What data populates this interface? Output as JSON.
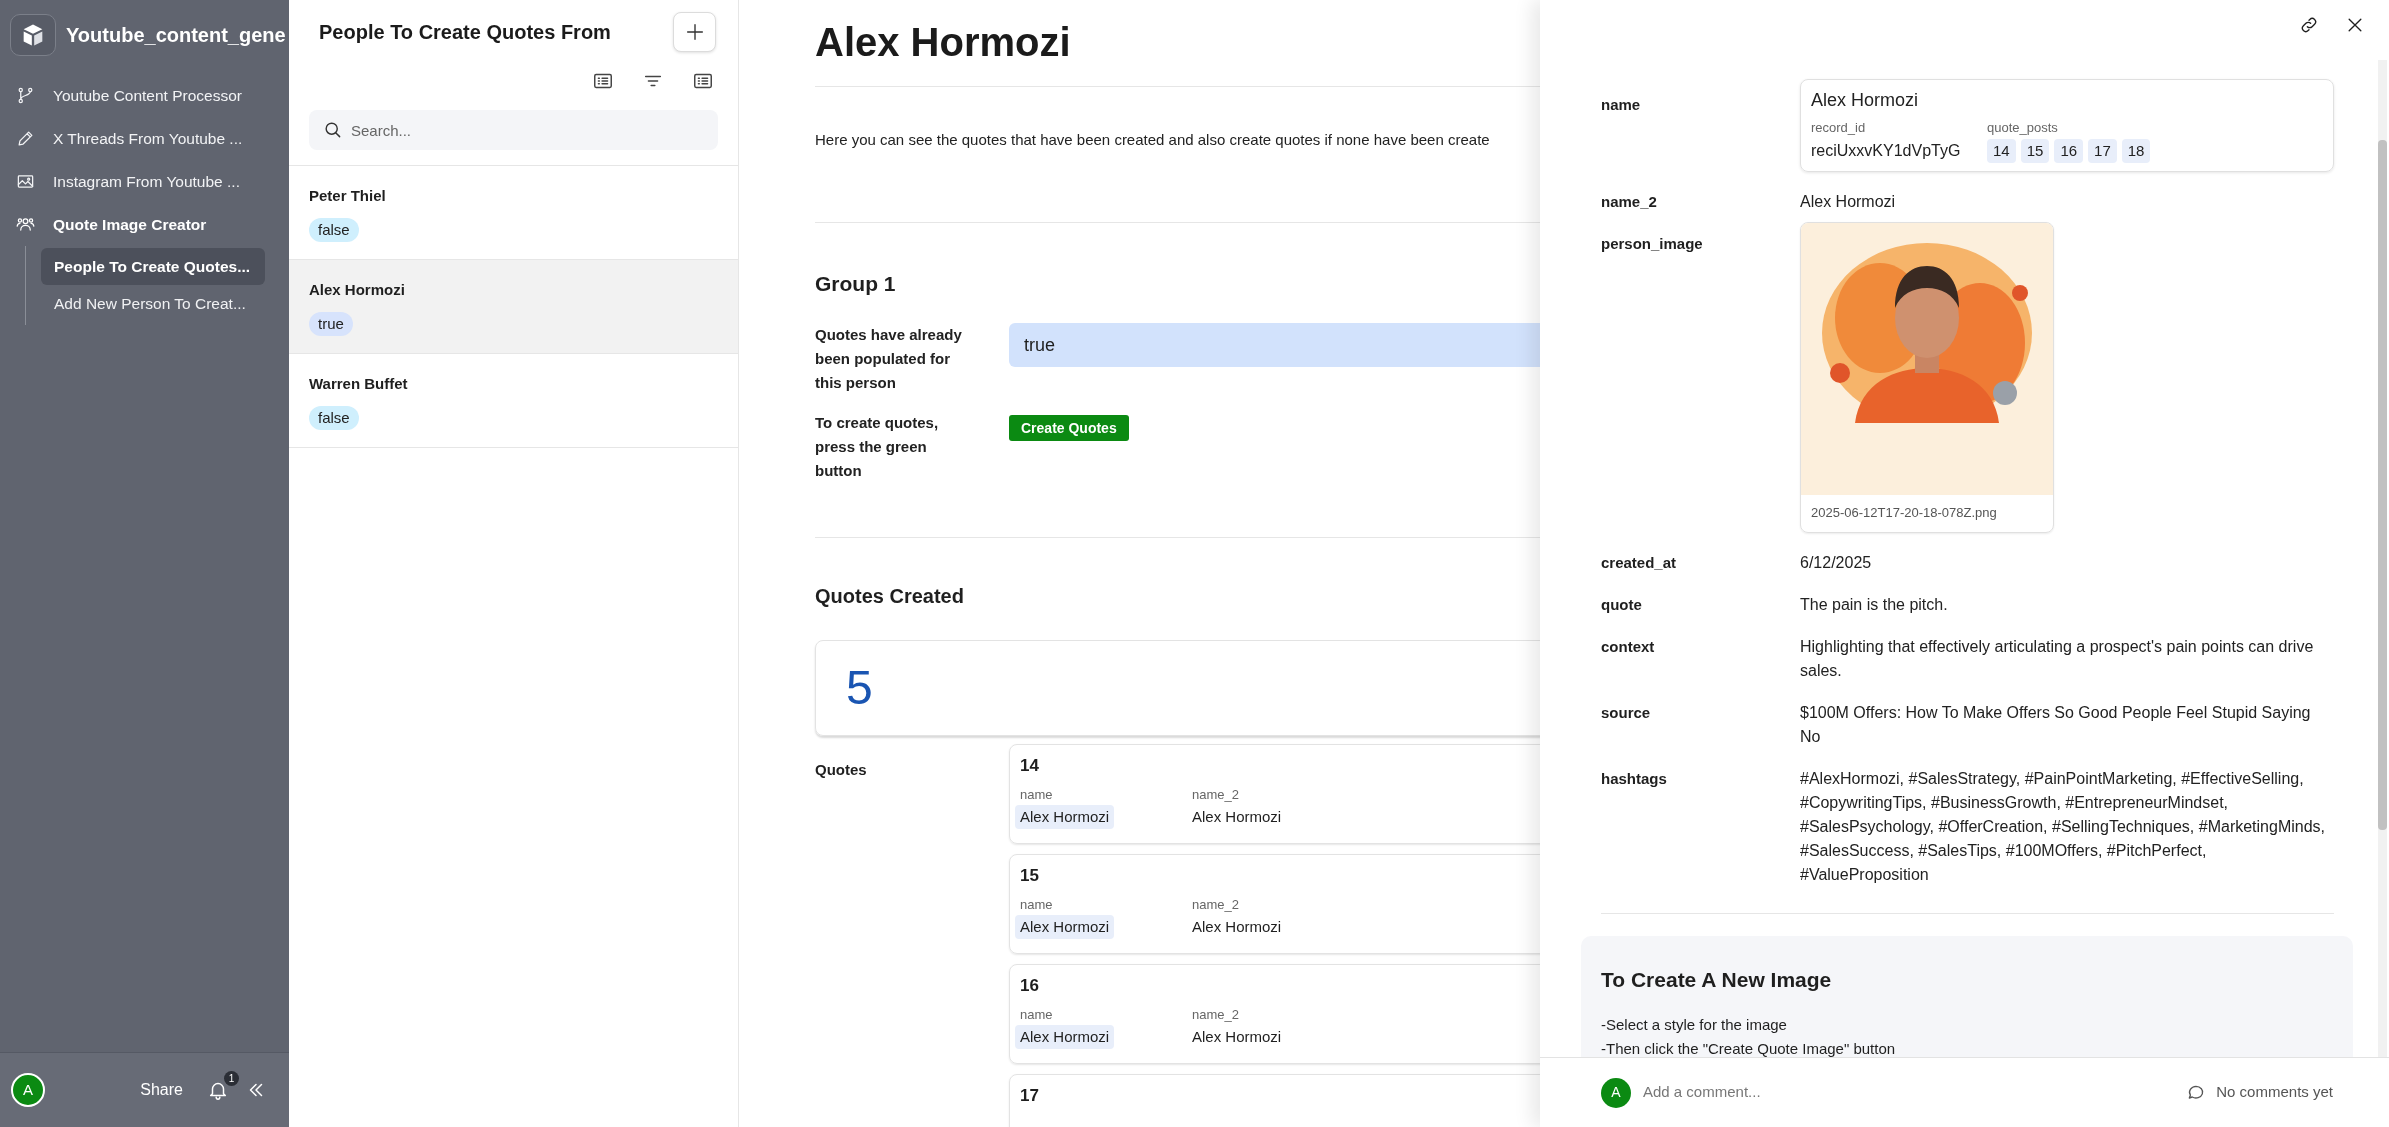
{
  "sidebar": {
    "workspace_title": "Youtube_content_gene",
    "items": [
      {
        "label": "Youtube Content Processor",
        "selected": false
      },
      {
        "label": "X Threads From Youtube ...",
        "selected": false
      },
      {
        "label": "Instagram From Youtube ...",
        "selected": false
      },
      {
        "label": "Quote Image Creator",
        "selected": false,
        "children": [
          {
            "label": "People To Create Quotes...",
            "selected": true
          },
          {
            "label": "Add New Person To Creat...",
            "selected": false
          }
        ]
      }
    ],
    "footer": {
      "avatar": "A",
      "share": "Share",
      "notification_count": "1"
    }
  },
  "list_panel": {
    "title": "People To Create Quotes From",
    "search": {
      "placeholder": "Search..."
    },
    "records": [
      {
        "name": "Peter Thiel",
        "flag": "false",
        "color": "#cfeffd",
        "selected": false
      },
      {
        "name": "Alex Hormozi",
        "flag": "true",
        "color": "#d7e3fc",
        "selected": true
      },
      {
        "name": "Warren Buffet",
        "flag": "false",
        "color": "#cfeffd",
        "selected": false
      }
    ]
  },
  "record": {
    "title": "Alex Hormozi",
    "description": "Here you can see the quotes that have been created and also create quotes if none have been create",
    "group_title": "Group 1",
    "fields": [
      {
        "label": "Quotes have already been populated for this person",
        "kind": "value",
        "value": "true"
      },
      {
        "label": "To create quotes, press the green button",
        "kind": "button",
        "value": "Create Quotes"
      }
    ],
    "quotes_title": "Quotes Created",
    "quotes_count": "5",
    "quotes_label": "Quotes",
    "cards": [
      {
        "number": "14",
        "columns": [
          {
            "label": "name",
            "value": "Alex Hormozi",
            "kind": "chip"
          },
          {
            "label": "name_2",
            "value": "Alex Hormozi",
            "kind": "plain"
          }
        ]
      },
      {
        "number": "15",
        "columns": [
          {
            "label": "name",
            "value": "Alex Hormozi",
            "kind": "chip"
          },
          {
            "label": "name_2",
            "value": "Alex Hormozi",
            "kind": "plain"
          }
        ]
      },
      {
        "number": "16",
        "columns": [
          {
            "label": "name",
            "value": "Alex Hormozi",
            "kind": "chip"
          },
          {
            "label": "name_2",
            "value": "Alex Hormozi",
            "kind": "plain"
          }
        ]
      },
      {
        "number": "17"
      }
    ]
  },
  "detail": {
    "fields": [
      {
        "label": "name",
        "kind": "linked_record",
        "title": "Alex Hormozi",
        "subfields": [
          {
            "label": "record_id",
            "value": "reciUxxvKY1dVpTyG"
          },
          {
            "label": "quote_posts",
            "chips": [
              "14",
              "15",
              "16",
              "17",
              "18"
            ]
          }
        ]
      },
      {
        "label": "name_2",
        "kind": "text",
        "value": "Alex Hormozi"
      },
      {
        "label": "person_image",
        "kind": "attachment",
        "filename": "2025-06-12T17-20-18-078Z.png"
      },
      {
        "label": "created_at",
        "kind": "text",
        "value": "6/12/2025"
      },
      {
        "label": "quote",
        "kind": "text",
        "value": "The pain is the pitch."
      },
      {
        "label": "context",
        "kind": "text",
        "value": "Highlighting that effectively articulating a prospect's pain points can drive sales."
      },
      {
        "label": "source",
        "kind": "text",
        "value": "$100M Offers: How To Make Offers So Good People Feel Stupid Saying No"
      },
      {
        "label": "hashtags",
        "kind": "text",
        "value": "#AlexHormozi, #SalesStrategy, #PainPointMarketing, #EffectiveSelling, #CopywritingTips, #BusinessGrowth, #EntrepreneurMindset, #SalesPsychology, #OfferCreation, #SellingTechniques, #MarketingMinds, #SalesSuccess, #SalesTips, #100MOffers, #PitchPerfect, #ValueProposition"
      }
    ],
    "instructions": {
      "title": "To Create A New Image",
      "lines": [
        "-Select a style for the image",
        "-Then click the \"Create Quote Image\" button"
      ]
    },
    "comment": {
      "avatar": "A",
      "placeholder": "Add a comment...",
      "status": "No comments yet"
    }
  }
}
